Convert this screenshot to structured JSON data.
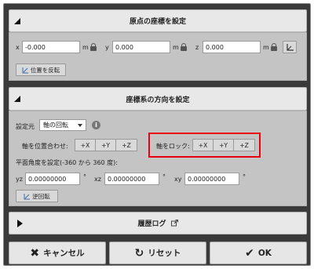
{
  "origin_panel": {
    "title": "原点の座標を設定",
    "x_label": "x",
    "x_value": "-0.000",
    "y_label": "y",
    "y_value": "0.000",
    "z_label": "z",
    "z_value": "0.000",
    "unit": "m",
    "flip_button": "位置を反転"
  },
  "orientation_panel": {
    "title": "座標系の方向を設定",
    "setting_source_label": "設定元",
    "setting_source_value": "軸の回転",
    "align_axis_label": "軸を位置合わせ:",
    "axis_buttons": [
      "+X",
      "+Y",
      "+Z"
    ],
    "lock_axis_label": "軸をロック:",
    "lock_buttons": [
      "+X",
      "+Y",
      "+Z"
    ],
    "plane_angle_label": "平面角度を設定(-360 から 360 度):",
    "yz_label": "yz",
    "yz_value": "0.00000000",
    "xz_label": "xz",
    "xz_value": "0.00000000",
    "xy_label": "xy",
    "xy_value": "0.00000000",
    "degree_symbol": "°",
    "reverse_button": "逆回転"
  },
  "history_panel": {
    "title": "履歴ログ"
  },
  "footer": {
    "cancel": "キャンセル",
    "reset": "リセット",
    "ok": "OK"
  },
  "colors": {
    "highlight_border": "#e60012",
    "dialog_bg": "#3a3a3a"
  }
}
